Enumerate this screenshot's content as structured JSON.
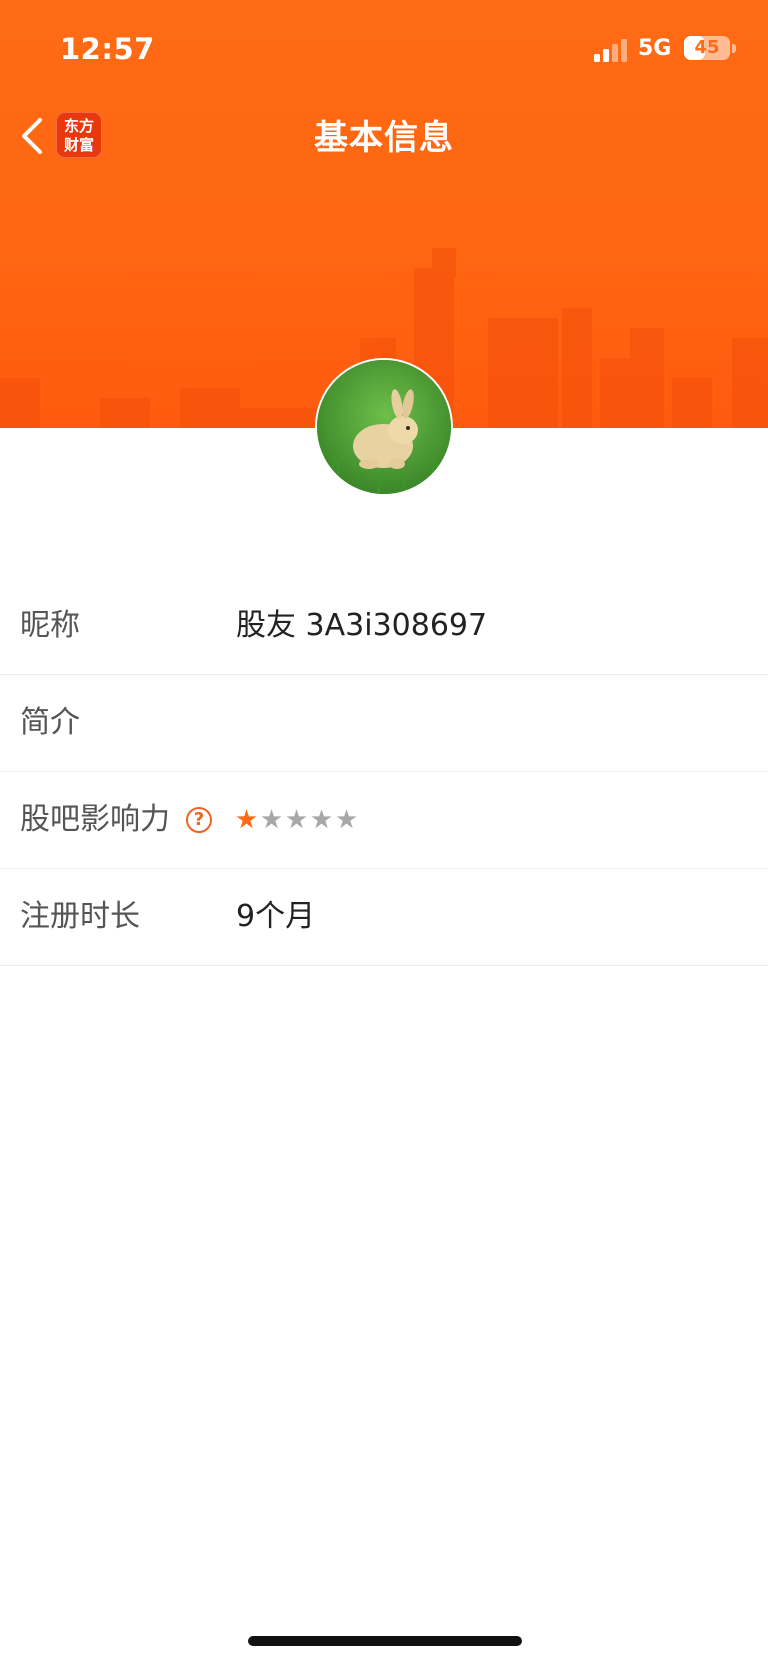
{
  "status_bar": {
    "time": "12:57",
    "network": "5G",
    "battery": "45",
    "battery_level": 0.45
  },
  "header": {
    "title": "基本信息",
    "logo_line1": "东方",
    "logo_line2": "财富",
    "accent_color": "#ff6a14"
  },
  "profile": {
    "avatar_icon": "rabbit-avatar",
    "rows": [
      {
        "label": "昵称",
        "value": "股友 3A3i308697"
      },
      {
        "label": "简介",
        "value": ""
      },
      {
        "label": "股吧影响力",
        "help_icon": "question-circle-icon",
        "rating": 1,
        "rating_max": 5
      },
      {
        "label": "注册时长",
        "value": "9个月"
      }
    ]
  }
}
